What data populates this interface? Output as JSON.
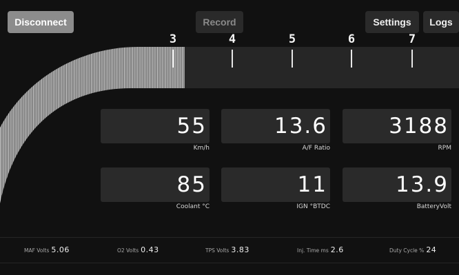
{
  "app": {
    "buttons": {
      "disconnect": "Disconnect",
      "record": "Record",
      "settings": "Settings",
      "logs": "Logs"
    }
  },
  "tachometer": {
    "tick_labels": [
      "3",
      "4",
      "5",
      "6",
      "7"
    ],
    "colors": {
      "track": "#262626",
      "fill": "#d0d0d0",
      "ticks": "#e8e8e8"
    }
  },
  "gauges": [
    {
      "value": "55",
      "unit": "Km/h"
    },
    {
      "value": "13.6",
      "unit": "A/F Ratio"
    },
    {
      "value": "3188",
      "unit": "RPM"
    },
    {
      "value": "85",
      "unit": "Coolant °C"
    },
    {
      "value": "11",
      "unit": "IGN °BTDC"
    },
    {
      "value": "13.9",
      "unit": "BatteryVolt"
    }
  ],
  "stats": [
    {
      "label": "MAF Volts",
      "value": "5.06"
    },
    {
      "label": "O2 Volts",
      "value": "0.43"
    },
    {
      "label": "TPS Volts",
      "value": "3.83"
    },
    {
      "label": "Inj. Time ms",
      "value": "2.6"
    },
    {
      "label": "Duty Cycle %",
      "value": "24"
    }
  ]
}
